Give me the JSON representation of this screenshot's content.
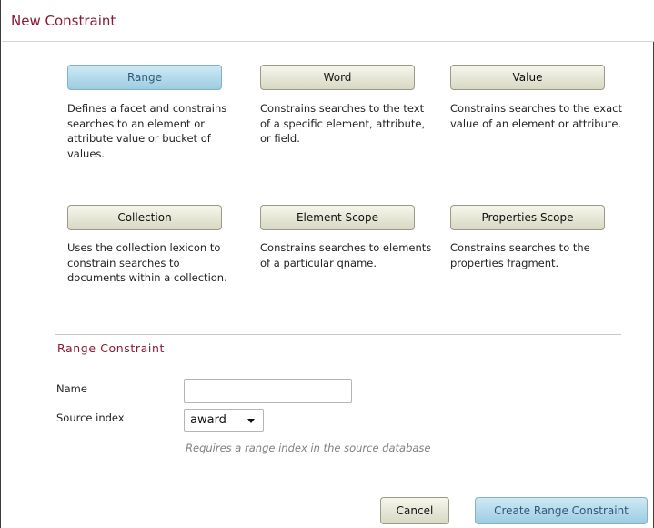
{
  "dialog": {
    "title": "New Constraint"
  },
  "constraint_types": [
    {
      "label": "Range",
      "description": "Defines a facet and constrains searches to an element or attribute value or bucket of values.",
      "selected": true
    },
    {
      "label": "Word",
      "description": "Constrains searches to the text of a specific element, attribute, or field.",
      "selected": false
    },
    {
      "label": "Value",
      "description": "Constrains searches to the exact value of an element or attribute.",
      "selected": false
    },
    {
      "label": "Collection",
      "description": "Uses the collection lexicon to constrain searches to documents within a collection.",
      "selected": false
    },
    {
      "label": "Element Scope",
      "description": "Constrains searches to elements of a particular qname.",
      "selected": false
    },
    {
      "label": "Properties Scope",
      "description": "Constrains searches to the properties fragment.",
      "selected": false
    }
  ],
  "form": {
    "section_title": "Range Constraint",
    "name_label": "Name",
    "name_value": "",
    "source_index_label": "Source index",
    "source_index_value": "award",
    "hint": "Requires a range index in the source database"
  },
  "actions": {
    "cancel_label": "Cancel",
    "create_label": "Create Range Constraint"
  },
  "colors": {
    "title": "#8a1a35",
    "selected_button": "#9ccde2",
    "default_button": "#d8d8c4",
    "hint_text": "#808080"
  },
  "icons": {
    "select_arrow": "chevron-down-icon"
  }
}
